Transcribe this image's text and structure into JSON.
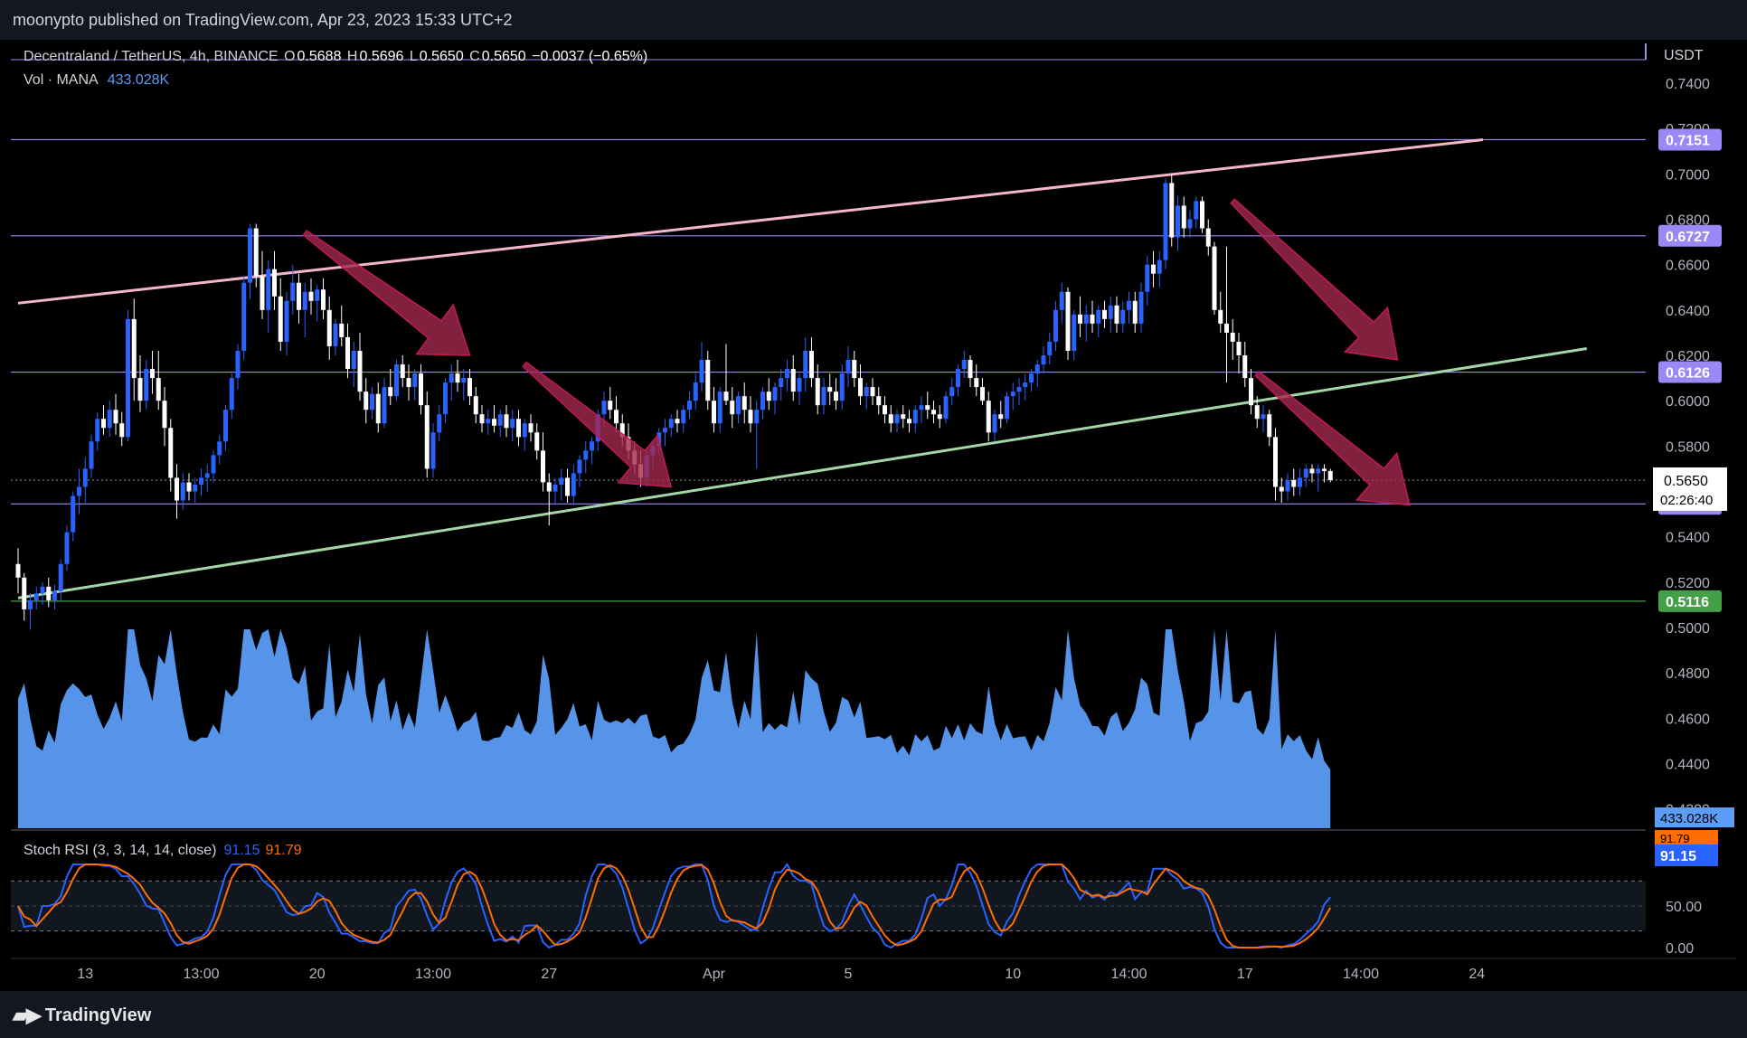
{
  "publisher_line": "moonypto published on TradingView.com, Apr 23, 2023 15:33 UTC+2",
  "brand": "TradingView",
  "brand_logo": "tradingview-logo-icon",
  "legend": {
    "symbol": "Decentraland / TetherUS, 4h, BINANCE",
    "open_label": "O",
    "open": "0.5688",
    "high_label": "H",
    "high": "0.5696",
    "low_label": "L",
    "low": "0.5650",
    "close_label": "C",
    "close": "0.5650",
    "change": "−0.0037 (−0.65%)",
    "vol_label": "Vol · MANA",
    "vol_value": "433.028K",
    "stoch_label": "Stoch RSI (3, 3, 14, 14, close)",
    "stoch_k": "91.15",
    "stoch_d": "91.79"
  },
  "colors": {
    "up": "#2962ff",
    "down": "#ffffff",
    "volume": "#5b9cf6",
    "channel_upper": "#f5b7c8",
    "channel_lower": "#a5d6a7",
    "level_line": "#9b87f5",
    "arrow": "#a3294e",
    "stoch_k": "#2962ff",
    "stoch_d": "#ff6d00"
  },
  "chart_data": {
    "type": "candlestick",
    "currency": "USDT",
    "ylim": [
      0.49,
      0.75
    ],
    "price_ticks": [
      "0.7400",
      "0.7200",
      "0.7000",
      "0.6800",
      "0.6600",
      "0.6400",
      "0.6200",
      "0.6000",
      "0.5800",
      "0.5400",
      "0.5200",
      "0.5000",
      "0.4800",
      "0.4600",
      "0.4400",
      "0.4200"
    ],
    "x_ticks": [
      "13",
      "13:00",
      "20",
      "13:00",
      "27",
      "Apr",
      "5",
      "10",
      "14:00",
      "17",
      "14:00",
      "24"
    ],
    "x_tick_index": [
      11,
      30,
      49,
      68,
      87,
      114,
      136,
      163,
      182,
      201,
      220,
      239
    ],
    "ohlc": [
      [
        0.528,
        0.535,
        0.515,
        0.522
      ],
      [
        0.522,
        0.524,
        0.503,
        0.508
      ],
      [
        0.508,
        0.515,
        0.499,
        0.512
      ],
      [
        0.512,
        0.518,
        0.508,
        0.515
      ],
      [
        0.515,
        0.52,
        0.51,
        0.518
      ],
      [
        0.518,
        0.522,
        0.509,
        0.512
      ],
      [
        0.512,
        0.519,
        0.508,
        0.516
      ],
      [
        0.516,
        0.53,
        0.512,
        0.528
      ],
      [
        0.528,
        0.545,
        0.525,
        0.542
      ],
      [
        0.542,
        0.56,
        0.538,
        0.558
      ],
      [
        0.558,
        0.57,
        0.55,
        0.562
      ],
      [
        0.562,
        0.575,
        0.555,
        0.57
      ],
      [
        0.57,
        0.585,
        0.566,
        0.582
      ],
      [
        0.582,
        0.595,
        0.578,
        0.592
      ],
      [
        0.592,
        0.598,
        0.585,
        0.588
      ],
      [
        0.588,
        0.6,
        0.584,
        0.596
      ],
      [
        0.596,
        0.603,
        0.585,
        0.59
      ],
      [
        0.59,
        0.595,
        0.58,
        0.584
      ],
      [
        0.584,
        0.64,
        0.582,
        0.636
      ],
      [
        0.636,
        0.645,
        0.6,
        0.61
      ],
      [
        0.61,
        0.62,
        0.595,
        0.6
      ],
      [
        0.6,
        0.618,
        0.596,
        0.614
      ],
      [
        0.614,
        0.622,
        0.603,
        0.61
      ],
      [
        0.61,
        0.622,
        0.596,
        0.6
      ],
      [
        0.6,
        0.606,
        0.58,
        0.588
      ],
      [
        0.588,
        0.592,
        0.56,
        0.566
      ],
      [
        0.566,
        0.572,
        0.548,
        0.556
      ],
      [
        0.556,
        0.568,
        0.552,
        0.564
      ],
      [
        0.564,
        0.568,
        0.556,
        0.56
      ],
      [
        0.56,
        0.566,
        0.555,
        0.563
      ],
      [
        0.563,
        0.57,
        0.558,
        0.566
      ],
      [
        0.566,
        0.572,
        0.56,
        0.568
      ],
      [
        0.568,
        0.578,
        0.564,
        0.576
      ],
      [
        0.576,
        0.585,
        0.572,
        0.582
      ],
      [
        0.582,
        0.598,
        0.578,
        0.596
      ],
      [
        0.596,
        0.612,
        0.592,
        0.61
      ],
      [
        0.61,
        0.625,
        0.605,
        0.622
      ],
      [
        0.622,
        0.655,
        0.618,
        0.652
      ],
      [
        0.652,
        0.678,
        0.645,
        0.676
      ],
      [
        0.676,
        0.678,
        0.65,
        0.655
      ],
      [
        0.655,
        0.666,
        0.636,
        0.64
      ],
      [
        0.64,
        0.662,
        0.63,
        0.658
      ],
      [
        0.658,
        0.666,
        0.64,
        0.646
      ],
      [
        0.646,
        0.654,
        0.622,
        0.626
      ],
      [
        0.626,
        0.648,
        0.62,
        0.644
      ],
      [
        0.644,
        0.66,
        0.638,
        0.652
      ],
      [
        0.652,
        0.656,
        0.634,
        0.64
      ],
      [
        0.64,
        0.652,
        0.628,
        0.648
      ],
      [
        0.648,
        0.654,
        0.638,
        0.644
      ],
      [
        0.644,
        0.651,
        0.635,
        0.649
      ],
      [
        0.649,
        0.654,
        0.636,
        0.64
      ],
      [
        0.64,
        0.646,
        0.618,
        0.624
      ],
      [
        0.624,
        0.636,
        0.62,
        0.634
      ],
      [
        0.634,
        0.642,
        0.624,
        0.628
      ],
      [
        0.628,
        0.634,
        0.61,
        0.614
      ],
      [
        0.614,
        0.626,
        0.606,
        0.622
      ],
      [
        0.622,
        0.63,
        0.6,
        0.604
      ],
      [
        0.604,
        0.61,
        0.59,
        0.596
      ],
      [
        0.596,
        0.606,
        0.592,
        0.603
      ],
      [
        0.603,
        0.608,
        0.586,
        0.59
      ],
      [
        0.59,
        0.61,
        0.588,
        0.606
      ],
      [
        0.606,
        0.614,
        0.598,
        0.602
      ],
      [
        0.602,
        0.618,
        0.6,
        0.616
      ],
      [
        0.616,
        0.62,
        0.606,
        0.61
      ],
      [
        0.61,
        0.616,
        0.6,
        0.606
      ],
      [
        0.606,
        0.614,
        0.6,
        0.612
      ],
      [
        0.612,
        0.616,
        0.594,
        0.598
      ],
      [
        0.598,
        0.604,
        0.566,
        0.57
      ],
      [
        0.57,
        0.59,
        0.566,
        0.586
      ],
      [
        0.586,
        0.598,
        0.582,
        0.594
      ],
      [
        0.594,
        0.61,
        0.59,
        0.608
      ],
      [
        0.608,
        0.616,
        0.6,
        0.612
      ],
      [
        0.612,
        0.618,
        0.604,
        0.608
      ],
      [
        0.608,
        0.614,
        0.6,
        0.61
      ],
      [
        0.61,
        0.614,
        0.598,
        0.602
      ],
      [
        0.602,
        0.606,
        0.59,
        0.594
      ],
      [
        0.594,
        0.598,
        0.586,
        0.59
      ],
      [
        0.59,
        0.596,
        0.585,
        0.592
      ],
      [
        0.592,
        0.598,
        0.586,
        0.589
      ],
      [
        0.589,
        0.596,
        0.584,
        0.594
      ],
      [
        0.594,
        0.598,
        0.584,
        0.588
      ],
      [
        0.588,
        0.596,
        0.582,
        0.592
      ],
      [
        0.592,
        0.596,
        0.58,
        0.584
      ],
      [
        0.584,
        0.592,
        0.578,
        0.59
      ],
      [
        0.59,
        0.594,
        0.582,
        0.586
      ],
      [
        0.586,
        0.59,
        0.574,
        0.578
      ],
      [
        0.578,
        0.586,
        0.56,
        0.564
      ],
      [
        0.564,
        0.568,
        0.545,
        0.56
      ],
      [
        0.56,
        0.566,
        0.554,
        0.563
      ],
      [
        0.563,
        0.57,
        0.556,
        0.566
      ],
      [
        0.566,
        0.57,
        0.555,
        0.558
      ],
      [
        0.558,
        0.572,
        0.554,
        0.568
      ],
      [
        0.568,
        0.576,
        0.562,
        0.574
      ],
      [
        0.574,
        0.582,
        0.568,
        0.578
      ],
      [
        0.578,
        0.584,
        0.572,
        0.582
      ],
      [
        0.582,
        0.596,
        0.578,
        0.594
      ],
      [
        0.594,
        0.604,
        0.588,
        0.6
      ],
      [
        0.6,
        0.606,
        0.592,
        0.596
      ],
      [
        0.596,
        0.602,
        0.586,
        0.59
      ],
      [
        0.59,
        0.594,
        0.58,
        0.584
      ],
      [
        0.584,
        0.59,
        0.574,
        0.578
      ],
      [
        0.578,
        0.582,
        0.568,
        0.572
      ],
      [
        0.572,
        0.578,
        0.562,
        0.566
      ],
      [
        0.566,
        0.578,
        0.562,
        0.576
      ],
      [
        0.576,
        0.582,
        0.57,
        0.58
      ],
      [
        0.58,
        0.588,
        0.576,
        0.586
      ],
      [
        0.586,
        0.592,
        0.58,
        0.588
      ],
      [
        0.588,
        0.594,
        0.584,
        0.592
      ],
      [
        0.592,
        0.596,
        0.586,
        0.59
      ],
      [
        0.59,
        0.598,
        0.586,
        0.596
      ],
      [
        0.596,
        0.604,
        0.592,
        0.6
      ],
      [
        0.6,
        0.612,
        0.596,
        0.608
      ],
      [
        0.608,
        0.626,
        0.604,
        0.618
      ],
      [
        0.618,
        0.622,
        0.596,
        0.6
      ],
      [
        0.6,
        0.606,
        0.586,
        0.59
      ],
      [
        0.59,
        0.606,
        0.586,
        0.604
      ],
      [
        0.604,
        0.625,
        0.598,
        0.6
      ],
      [
        0.6,
        0.606,
        0.588,
        0.594
      ],
      [
        0.594,
        0.604,
        0.59,
        0.602
      ],
      [
        0.602,
        0.608,
        0.59,
        0.596
      ],
      [
        0.596,
        0.602,
        0.586,
        0.59
      ],
      [
        0.59,
        0.6,
        0.57,
        0.596
      ],
      [
        0.596,
        0.606,
        0.592,
        0.604
      ],
      [
        0.604,
        0.61,
        0.596,
        0.6
      ],
      [
        0.6,
        0.608,
        0.594,
        0.606
      ],
      [
        0.606,
        0.614,
        0.6,
        0.61
      ],
      [
        0.61,
        0.618,
        0.604,
        0.614
      ],
      [
        0.614,
        0.62,
        0.6,
        0.604
      ],
      [
        0.604,
        0.612,
        0.598,
        0.61
      ],
      [
        0.61,
        0.628,
        0.604,
        0.622
      ],
      [
        0.622,
        0.628,
        0.606,
        0.61
      ],
      [
        0.61,
        0.616,
        0.594,
        0.598
      ],
      [
        0.598,
        0.61,
        0.594,
        0.606
      ],
      [
        0.606,
        0.612,
        0.598,
        0.604
      ],
      [
        0.604,
        0.61,
        0.596,
        0.6
      ],
      [
        0.6,
        0.616,
        0.596,
        0.612
      ],
      [
        0.612,
        0.624,
        0.606,
        0.618
      ],
      [
        0.618,
        0.622,
        0.606,
        0.61
      ],
      [
        0.61,
        0.616,
        0.598,
        0.602
      ],
      [
        0.602,
        0.608,
        0.596,
        0.606
      ],
      [
        0.606,
        0.61,
        0.598,
        0.602
      ],
      [
        0.602,
        0.606,
        0.594,
        0.598
      ],
      [
        0.598,
        0.602,
        0.59,
        0.594
      ],
      [
        0.594,
        0.598,
        0.586,
        0.59
      ],
      [
        0.59,
        0.596,
        0.586,
        0.594
      ],
      [
        0.594,
        0.598,
        0.588,
        0.592
      ],
      [
        0.592,
        0.596,
        0.586,
        0.59
      ],
      [
        0.59,
        0.598,
        0.586,
        0.596
      ],
      [
        0.596,
        0.602,
        0.59,
        0.598
      ],
      [
        0.598,
        0.604,
        0.592,
        0.596
      ],
      [
        0.596,
        0.6,
        0.59,
        0.594
      ],
      [
        0.594,
        0.598,
        0.588,
        0.592
      ],
      [
        0.592,
        0.604,
        0.59,
        0.602
      ],
      [
        0.602,
        0.61,
        0.598,
        0.606
      ],
      [
        0.606,
        0.616,
        0.602,
        0.614
      ],
      [
        0.614,
        0.622,
        0.61,
        0.618
      ],
      [
        0.618,
        0.62,
        0.606,
        0.61
      ],
      [
        0.61,
        0.616,
        0.602,
        0.606
      ],
      [
        0.606,
        0.61,
        0.598,
        0.6
      ],
      [
        0.6,
        0.604,
        0.582,
        0.586
      ],
      [
        0.586,
        0.596,
        0.582,
        0.594
      ],
      [
        0.594,
        0.6,
        0.588,
        0.592
      ],
      [
        0.592,
        0.604,
        0.59,
        0.602
      ],
      [
        0.602,
        0.608,
        0.596,
        0.604
      ],
      [
        0.604,
        0.61,
        0.598,
        0.606
      ],
      [
        0.606,
        0.612,
        0.6,
        0.608
      ],
      [
        0.608,
        0.614,
        0.604,
        0.612
      ],
      [
        0.612,
        0.618,
        0.606,
        0.616
      ],
      [
        0.616,
        0.624,
        0.612,
        0.62
      ],
      [
        0.62,
        0.63,
        0.616,
        0.626
      ],
      [
        0.626,
        0.644,
        0.622,
        0.64
      ],
      [
        0.64,
        0.652,
        0.634,
        0.648
      ],
      [
        0.648,
        0.65,
        0.618,
        0.622
      ],
      [
        0.622,
        0.64,
        0.618,
        0.638
      ],
      [
        0.638,
        0.646,
        0.628,
        0.634
      ],
      [
        0.634,
        0.642,
        0.626,
        0.638
      ],
      [
        0.638,
        0.644,
        0.63,
        0.634
      ],
      [
        0.634,
        0.642,
        0.628,
        0.64
      ],
      [
        0.64,
        0.644,
        0.632,
        0.636
      ],
      [
        0.636,
        0.646,
        0.63,
        0.642
      ],
      [
        0.642,
        0.646,
        0.63,
        0.634
      ],
      [
        0.634,
        0.644,
        0.63,
        0.64
      ],
      [
        0.64,
        0.648,
        0.634,
        0.644
      ],
      [
        0.644,
        0.648,
        0.63,
        0.634
      ],
      [
        0.634,
        0.652,
        0.63,
        0.648
      ],
      [
        0.648,
        0.664,
        0.642,
        0.66
      ],
      [
        0.66,
        0.666,
        0.65,
        0.656
      ],
      [
        0.656,
        0.666,
        0.65,
        0.662
      ],
      [
        0.662,
        0.698,
        0.658,
        0.696
      ],
      [
        0.696,
        0.7,
        0.668,
        0.672
      ],
      [
        0.672,
        0.69,
        0.666,
        0.686
      ],
      [
        0.686,
        0.69,
        0.672,
        0.676
      ],
      [
        0.676,
        0.684,
        0.672,
        0.68
      ],
      [
        0.68,
        0.69,
        0.676,
        0.688
      ],
      [
        0.688,
        0.69,
        0.674,
        0.676
      ],
      [
        0.676,
        0.68,
        0.664,
        0.668
      ],
      [
        0.668,
        0.67,
        0.638,
        0.64
      ],
      [
        0.64,
        0.648,
        0.63,
        0.634
      ],
      [
        0.634,
        0.668,
        0.608,
        0.63
      ],
      [
        0.63,
        0.636,
        0.618,
        0.626
      ],
      [
        0.626,
        0.63,
        0.612,
        0.62
      ],
      [
        0.62,
        0.626,
        0.606,
        0.61
      ],
      [
        0.61,
        0.614,
        0.594,
        0.598
      ],
      [
        0.598,
        0.602,
        0.588,
        0.592
      ],
      [
        0.592,
        0.598,
        0.586,
        0.594
      ],
      [
        0.594,
        0.596,
        0.58,
        0.584
      ],
      [
        0.584,
        0.588,
        0.556,
        0.562
      ],
      [
        0.562,
        0.566,
        0.555,
        0.56
      ],
      [
        0.56,
        0.568,
        0.556,
        0.565
      ],
      [
        0.565,
        0.57,
        0.558,
        0.562
      ],
      [
        0.562,
        0.57,
        0.558,
        0.566
      ],
      [
        0.566,
        0.572,
        0.562,
        0.57
      ],
      [
        0.57,
        0.572,
        0.564,
        0.568
      ],
      [
        0.568,
        0.572,
        0.56,
        0.57
      ],
      [
        0.57,
        0.572,
        0.564,
        0.569
      ],
      [
        0.569,
        0.57,
        0.564,
        0.565
      ]
    ],
    "volume_hint": "relative volume per candle",
    "horizontal_levels": [
      {
        "price": 0.7151,
        "label": "0.7151",
        "color": "#9b87f5"
      },
      {
        "price": 0.6727,
        "label": "0.6727",
        "color": "#9b87f5"
      },
      {
        "price": 0.6126,
        "label": "0.6126",
        "color": "#9b87f5"
      },
      {
        "price": 0.5545,
        "label": "0.5545",
        "color": "#9b87f5"
      },
      {
        "price": 0.5116,
        "label": "0.5116",
        "color": "#43a047"
      }
    ],
    "top_level_price": 0.75,
    "last_price": {
      "price": 0.565,
      "label": "0.5650",
      "countdown": "02:26:40"
    },
    "volume_badge": "433.028K",
    "stoch_badges": {
      "k": "91.15",
      "d": "91.79"
    },
    "stoch_ticks": [
      "50.00",
      "0.00"
    ],
    "stoch_ylim": [
      0,
      100
    ],
    "channel_upper": {
      "from": [
        0,
        0.643
      ],
      "to": [
        240,
        0.7151
      ]
    },
    "channel_lower": {
      "from": [
        0,
        0.513
      ],
      "to": [
        257,
        0.623
      ]
    },
    "arrows": [
      {
        "from": [
          47,
          0.674
        ],
        "to": [
          74,
          0.62
        ]
      },
      {
        "from": [
          83,
          0.616
        ],
        "to": [
          107,
          0.562
        ]
      },
      {
        "from": [
          199,
          0.688
        ],
        "to": [
          226,
          0.618
        ]
      },
      {
        "from": [
          203,
          0.612
        ],
        "to": [
          228,
          0.554
        ]
      }
    ]
  }
}
